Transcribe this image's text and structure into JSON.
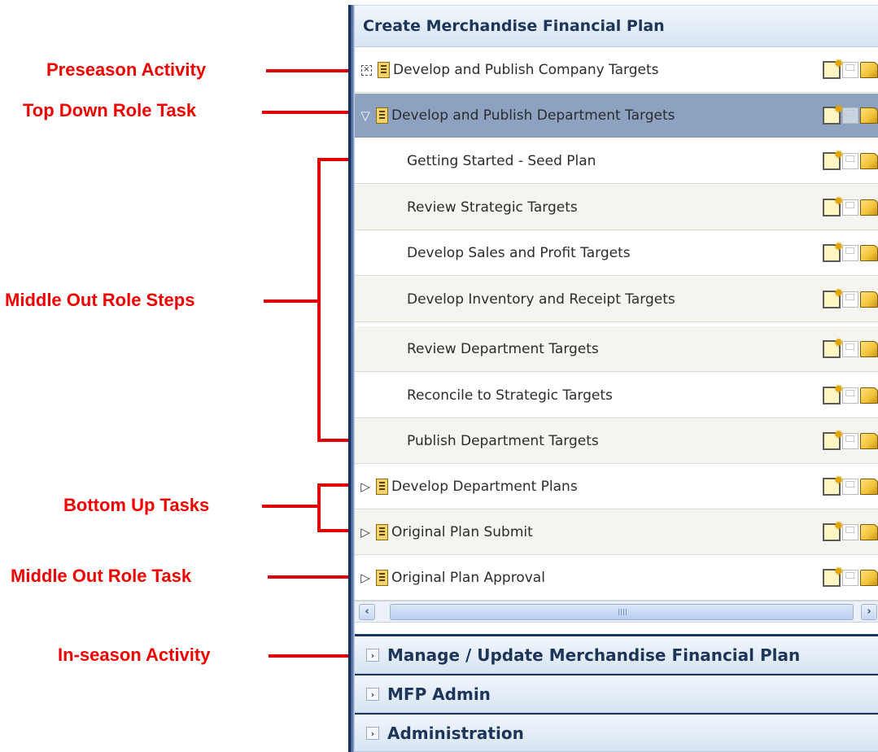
{
  "annotations": {
    "preseason_activity": "Preseason Activity",
    "top_down_role_task": "Top Down Role Task",
    "middle_out_role_steps": "Middle Out Role Steps",
    "bottom_up_tasks": "Bottom Up Tasks",
    "middle_out_role_task": "Middle Out Role Task",
    "in_season_activity": "In-season Activity"
  },
  "panel": {
    "title": "Create Merchandise Financial Plan",
    "rows": [
      {
        "label": "Develop and Publish Company Targets",
        "kind": "activity",
        "expander": "dashed-box"
      },
      {
        "label": "Develop and Publish Department Targets",
        "kind": "task",
        "expander": "expanded",
        "selected": true
      },
      {
        "label": "Getting Started - Seed Plan",
        "kind": "step"
      },
      {
        "label": "Review Strategic Targets",
        "kind": "step"
      },
      {
        "label": "Develop Sales and Profit Targets",
        "kind": "step"
      },
      {
        "label": "Develop Inventory and Receipt Targets",
        "kind": "step"
      },
      {
        "label": "Review Department Targets",
        "kind": "step"
      },
      {
        "label": "Reconcile to Strategic Targets",
        "kind": "step"
      },
      {
        "label": "Publish Department Targets",
        "kind": "step"
      },
      {
        "label": "Develop Department Plans",
        "kind": "task",
        "expander": "collapsed"
      },
      {
        "label": "Original Plan Submit",
        "kind": "task",
        "expander": "collapsed"
      },
      {
        "label": "Original Plan Approval",
        "kind": "task",
        "expander": "collapsed"
      }
    ],
    "row_actions": [
      "new-workbook-icon",
      "save-icon",
      "open-workbook-icon"
    ],
    "sections": [
      {
        "title": "Manage / Update Merchandise Financial Plan"
      },
      {
        "title": "MFP Admin"
      },
      {
        "title": "Administration"
      }
    ]
  },
  "colors": {
    "annotation": "#f20000",
    "header_text": "#1d3559",
    "selected_row": "#8da1c1",
    "alt_row": "#f5f4ee",
    "panel_edge": "#17305b"
  }
}
